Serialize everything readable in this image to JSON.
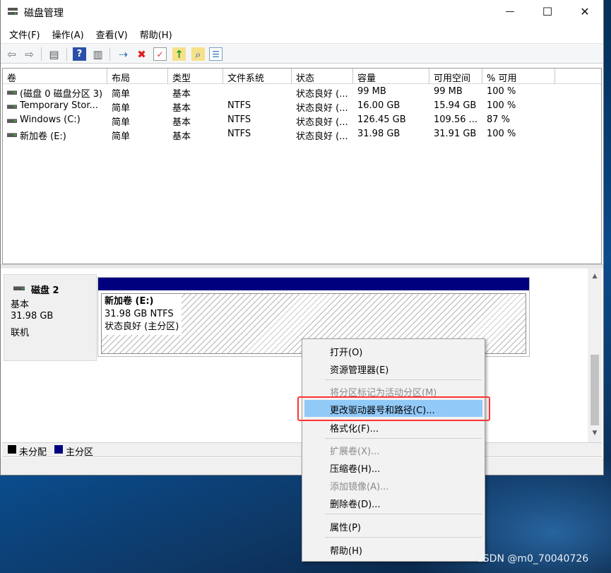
{
  "window": {
    "title": "磁盘管理",
    "controls": {
      "minimize": "—",
      "maximize": "☐",
      "close": "✕"
    }
  },
  "menu": [
    "文件(F)",
    "操作(A)",
    "查看(V)",
    "帮助(H)"
  ],
  "toolbar_icons": [
    {
      "name": "back-arrow-icon",
      "glyph": "⇦"
    },
    {
      "name": "forward-arrow-icon",
      "glyph": "⇨"
    },
    {
      "name": "volume-list-icon",
      "glyph": "▤"
    },
    {
      "name": "help-icon",
      "glyph": "?"
    },
    {
      "name": "disk-view-icon",
      "glyph": "▥"
    },
    {
      "name": "connect-icon",
      "glyph": "⇢"
    },
    {
      "name": "delete-icon",
      "glyph": "✖"
    },
    {
      "name": "properties-icon",
      "glyph": "✓"
    },
    {
      "name": "export-icon",
      "glyph": "↑"
    },
    {
      "name": "search-icon",
      "glyph": "⌕"
    },
    {
      "name": "list-icon",
      "glyph": "☰"
    }
  ],
  "volumes": {
    "columns": [
      "卷",
      "布局",
      "类型",
      "文件系统",
      "状态",
      "容量",
      "可用空间",
      "% 可用"
    ],
    "rows": [
      [
        "(磁盘 0 磁盘分区 3)",
        "简单",
        "基本",
        "",
        "状态良好 (...",
        "99 MB",
        "99 MB",
        "100 %"
      ],
      [
        "Temporary Stor...",
        "简单",
        "基本",
        "NTFS",
        "状态良好 (...",
        "16.00 GB",
        "15.94 GB",
        "100 %"
      ],
      [
        "Windows (C:)",
        "简单",
        "基本",
        "NTFS",
        "状态良好 (...",
        "126.45 GB",
        "109.56 ...",
        "87 %"
      ],
      [
        "新加卷 (E:)",
        "简单",
        "基本",
        "NTFS",
        "状态良好 (...",
        "31.98 GB",
        "31.91 GB",
        "100 %"
      ]
    ]
  },
  "disk": {
    "name": "磁盘 2",
    "type": "基本",
    "size": "31.98 GB",
    "status": "联机",
    "partition": {
      "name": "新加卷  (E:)",
      "size_fs": "31.98 GB NTFS",
      "status": "状态良好 (主分区)",
      "bar_color": "#00007f"
    }
  },
  "legend": [
    {
      "label": "未分配",
      "color": "#000000"
    },
    {
      "label": "主分区",
      "color": "#00007f"
    }
  ],
  "context_menu": {
    "items": [
      {
        "label": "打开(O)",
        "disabled": false
      },
      {
        "label": "资源管理器(E)",
        "disabled": false
      },
      {
        "label": "将分区标记为活动分区(M)",
        "disabled": true
      },
      {
        "label": "更改驱动器号和路径(C)...",
        "disabled": false,
        "highlighted": true
      },
      {
        "label": "格式化(F)...",
        "disabled": false
      },
      {
        "label": "扩展卷(X)...",
        "disabled": true
      },
      {
        "label": "压缩卷(H)...",
        "disabled": false
      },
      {
        "label": "添加镜像(A)...",
        "disabled": true
      },
      {
        "label": "删除卷(D)...",
        "disabled": false
      },
      {
        "label": "属性(P)",
        "disabled": false
      },
      {
        "label": "帮助(H)",
        "disabled": false
      }
    ],
    "highlight_color": "#91c9f7",
    "annotation_color": "#ff3333"
  },
  "watermark": "CSDN @m0_70040726"
}
